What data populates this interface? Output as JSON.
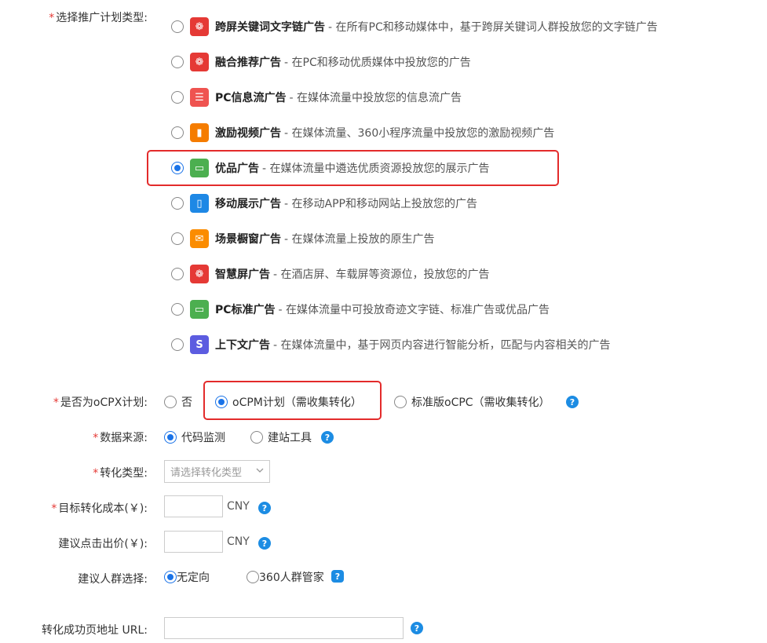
{
  "plan_type": {
    "required_mark": "*",
    "label": "选择推广计划类型:",
    "options": [
      {
        "name": "跨屏关键词文字链广告",
        "desc": "- 在所有PC和移动媒体中，基于跨屏关键词人群投放您的文字链广告",
        "icon": "dragon-icon",
        "color": "#e53935",
        "checked": false
      },
      {
        "name": "融合推荐广告",
        "desc": "- 在PC和移动优质媒体中投放您的广告",
        "icon": "dragon-icon",
        "color": "#e53935",
        "checked": false
      },
      {
        "name": "PC信息流广告",
        "desc": "- 在媒体流量中投放您的信息流广告",
        "icon": "list-icon",
        "color": "#ef5350",
        "checked": false
      },
      {
        "name": "激励视频广告",
        "desc": "- 在媒体流量、360小程序流量中投放您的激励视频广告",
        "icon": "video-icon",
        "color": "#f57c00",
        "checked": false
      },
      {
        "name": "优品广告",
        "desc": "- 在媒体流量中遴选优质资源投放您的展示广告",
        "icon": "monitor-icon",
        "color": "#4caf50",
        "checked": true
      },
      {
        "name": "移动展示广告",
        "desc": "- 在移动APP和移动网站上投放您的广告",
        "icon": "mobile-icon",
        "color": "#1e88e5",
        "checked": false
      },
      {
        "name": "场景橱窗广告",
        "desc": "- 在媒体流量上投放的原生广告",
        "icon": "bag-icon",
        "color": "#fb8c00",
        "checked": false
      },
      {
        "name": "智慧屏广告",
        "desc": "- 在酒店屏、车载屏等资源位，投放您的广告",
        "icon": "dragon-icon",
        "color": "#e53935",
        "checked": false
      },
      {
        "name": "PC标准广告",
        "desc": "- 在媒体流量中可投放奇迹文字链、标准广告或优品广告",
        "icon": "monitor-icon",
        "color": "#4caf50",
        "checked": false
      },
      {
        "name": "上下文广告",
        "desc": "- 在媒体流量中，基于网页内容进行智能分析，匹配与内容相关的广告",
        "icon": "context-icon",
        "color": "#5c5ce0",
        "checked": false
      }
    ]
  },
  "ocpx": {
    "required_mark": "*",
    "label": "是否为oCPX计划:",
    "options": [
      {
        "text": "否",
        "checked": false
      },
      {
        "text": "oCPM计划（需收集转化）",
        "checked": true
      },
      {
        "text": "标准版oCPC（需收集转化）",
        "checked": false
      }
    ],
    "help": "?"
  },
  "data_source": {
    "required_mark": "*",
    "label": "数据来源:",
    "options": [
      {
        "text": "代码监测",
        "checked": true
      },
      {
        "text": "建站工具",
        "checked": false
      }
    ],
    "help": "?"
  },
  "conversion_type": {
    "required_mark": "*",
    "label": "转化类型:",
    "placeholder": "请选择转化类型"
  },
  "target_cost": {
    "required_mark": "*",
    "label": "目标转化成本(￥):",
    "value": "",
    "unit": "CNY",
    "help": "?"
  },
  "suggested_bid": {
    "label": "建议点击出价(￥):",
    "value": "",
    "unit": "CNY",
    "help": "?"
  },
  "audience": {
    "label": "建议人群选择:",
    "options": [
      {
        "text": "无定向",
        "checked": true
      },
      {
        "text": "360人群管家",
        "checked": false
      }
    ],
    "help": "?"
  },
  "success_url": {
    "label": "转化成功页地址 URL:",
    "value": "",
    "help": "?"
  },
  "colors": {
    "accent": "#1a73e8",
    "highlight": "#e32b2b",
    "required": "#e53935",
    "help": "#1c8ce3"
  }
}
